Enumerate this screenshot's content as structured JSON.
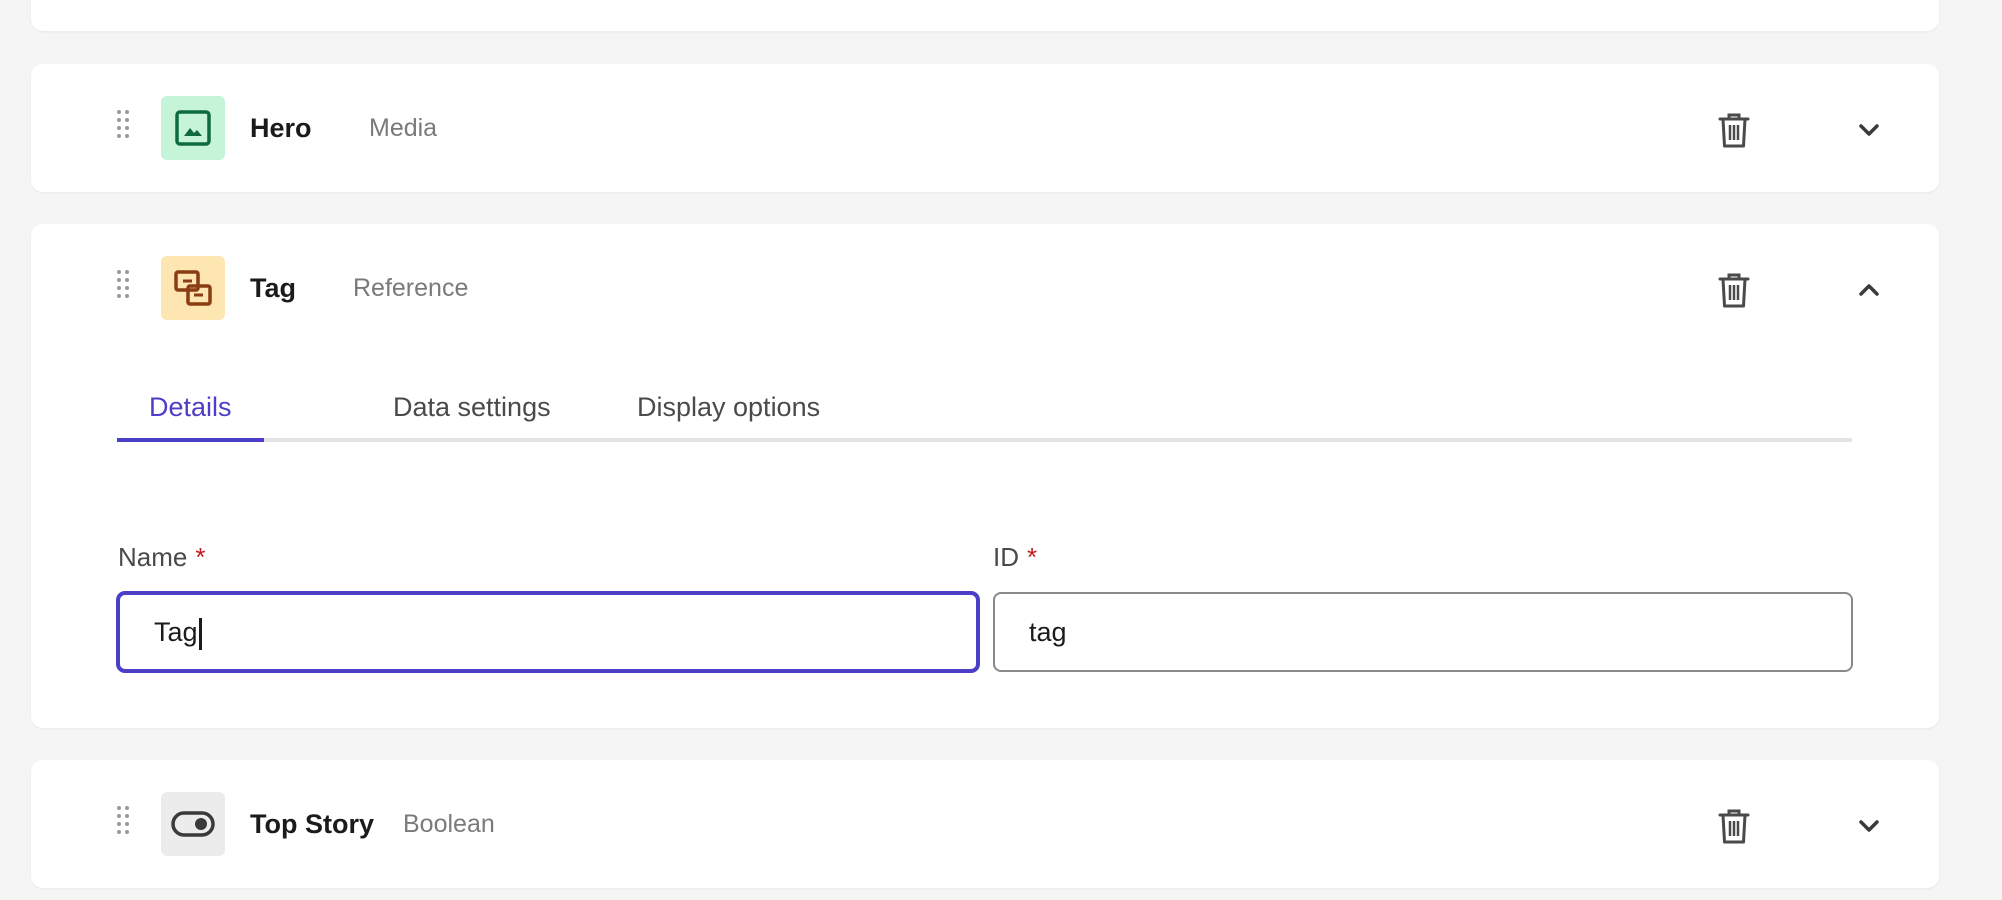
{
  "fields": {
    "hero": {
      "name": "Hero",
      "type": "Media",
      "icon": "image-icon",
      "icon_bg": "#c6f4d9",
      "icon_color": "#0f6b3f"
    },
    "tag": {
      "name": "Tag",
      "type": "Reference",
      "icon": "reference-icon",
      "icon_bg": "#fde6b2",
      "icon_color": "#8a3c12"
    },
    "top_story": {
      "name": "Top Story",
      "type": "Boolean",
      "icon": "toggle-icon",
      "icon_bg": "#ececec",
      "icon_color": "#3a3a3a"
    }
  },
  "editor": {
    "tabs": [
      {
        "label": "Details",
        "active": true
      },
      {
        "label": "Data settings",
        "active": false
      },
      {
        "label": "Display options",
        "active": false
      }
    ],
    "name_label": "Name",
    "name_required": "*",
    "name_value": "Tag",
    "id_label": "ID",
    "id_required": "*",
    "id_value": "tag"
  },
  "colors": {
    "accent": "#4b3fc8",
    "required": "#c21b1b"
  }
}
